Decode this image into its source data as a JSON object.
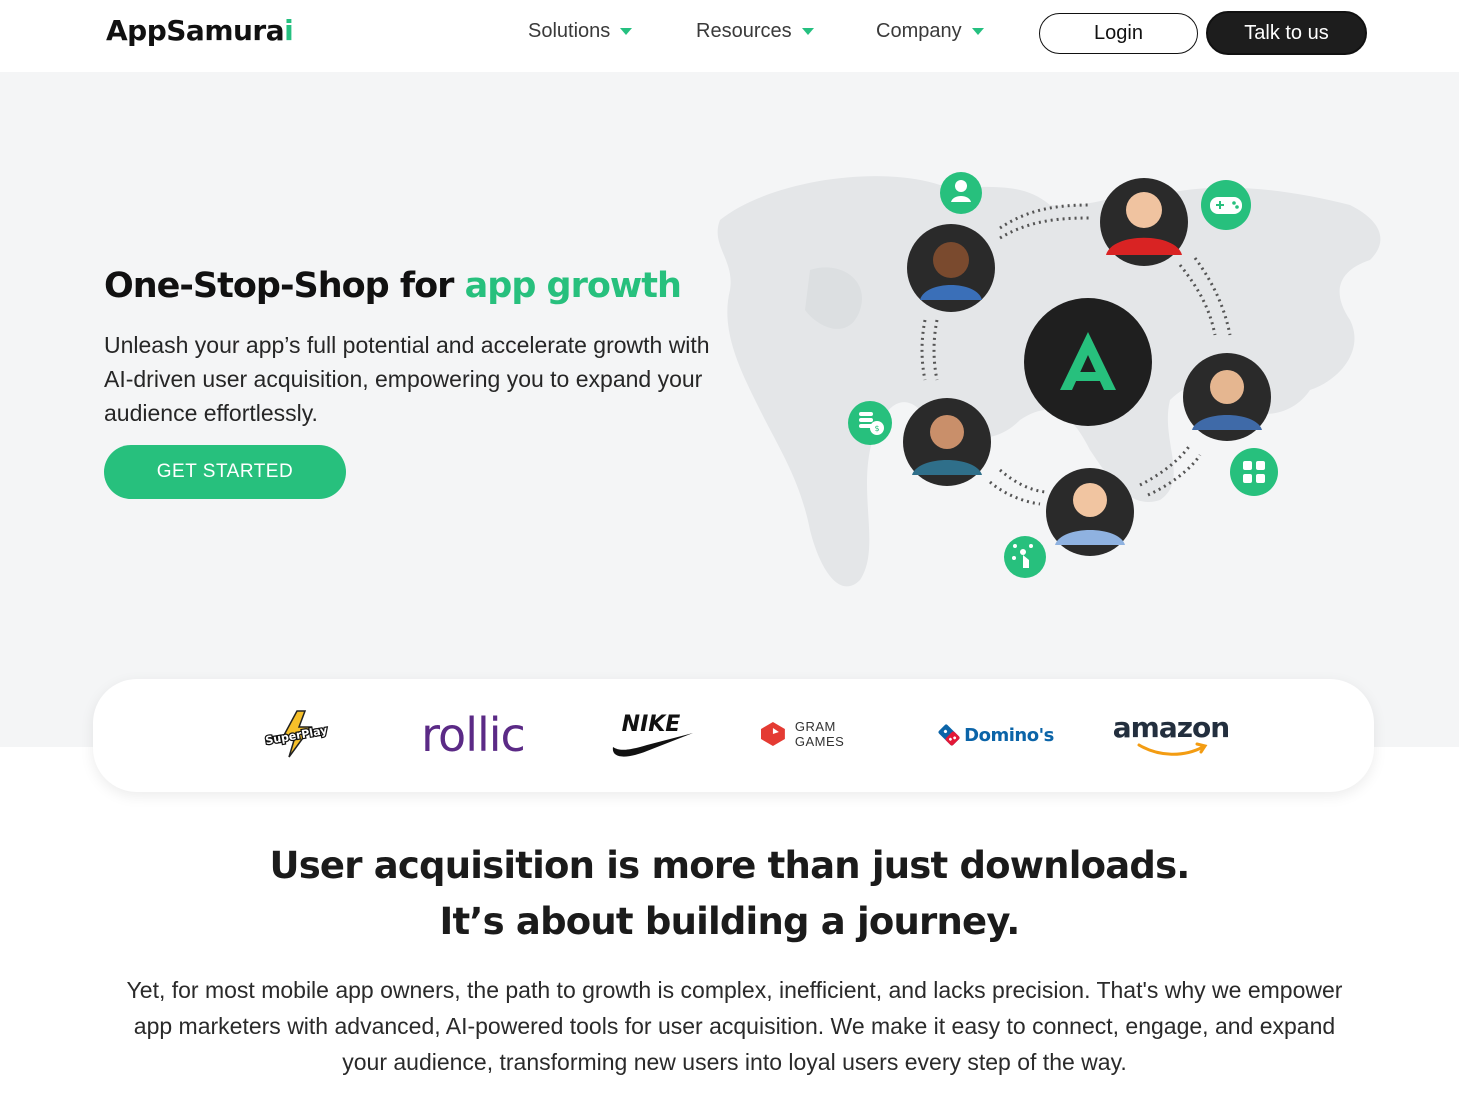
{
  "nav": {
    "logo_main": "AppSamura",
    "logo_end": "i",
    "items": [
      {
        "label": "Solutions"
      },
      {
        "label": "Resources"
      },
      {
        "label": "Company"
      }
    ],
    "login_label": "Login",
    "talk_label": "Talk to us"
  },
  "hero": {
    "title_plain": "One-Stop-Shop for ",
    "title_accent": "app growth",
    "subtitle": "Unleash your app’s full potential and accelerate growth with AI-driven user acquisition, empowering you to expand your audience effortlessly.",
    "cta_label": "GET STARTED",
    "center_logo_letter": "A",
    "icons": [
      "user-icon",
      "gamepad-icon",
      "coins-icon",
      "apps-grid-icon",
      "network-tap-icon"
    ],
    "avatars": [
      "avatar-woman-smiling",
      "avatar-man-excited",
      "avatar-man-phone",
      "avatar-woman-phone",
      "avatar-woman-blonde"
    ]
  },
  "brands": {
    "superplay": "SuperPlay",
    "rollic": "rollic",
    "nike": "NIKE",
    "gram": "GRAM GAMES",
    "dominos": "Domino's",
    "amazon": "amazon"
  },
  "content": {
    "headline_1": "User acquisition is more than just downloads.",
    "headline_2": "It’s about building a journey.",
    "body": "Yet, for most mobile app owners, the path to growth is complex, inefficient, and lacks precision. That's why we empower app marketers with advanced, AI-powered tools for user acquisition. We make it easy to connect, engage, and expand your audience, transforming new users into loyal users every step of the way."
  },
  "colors": {
    "accent_green": "#27c07d",
    "dark": "#1d1d1d",
    "hero_bg": "#f4f5f6"
  }
}
